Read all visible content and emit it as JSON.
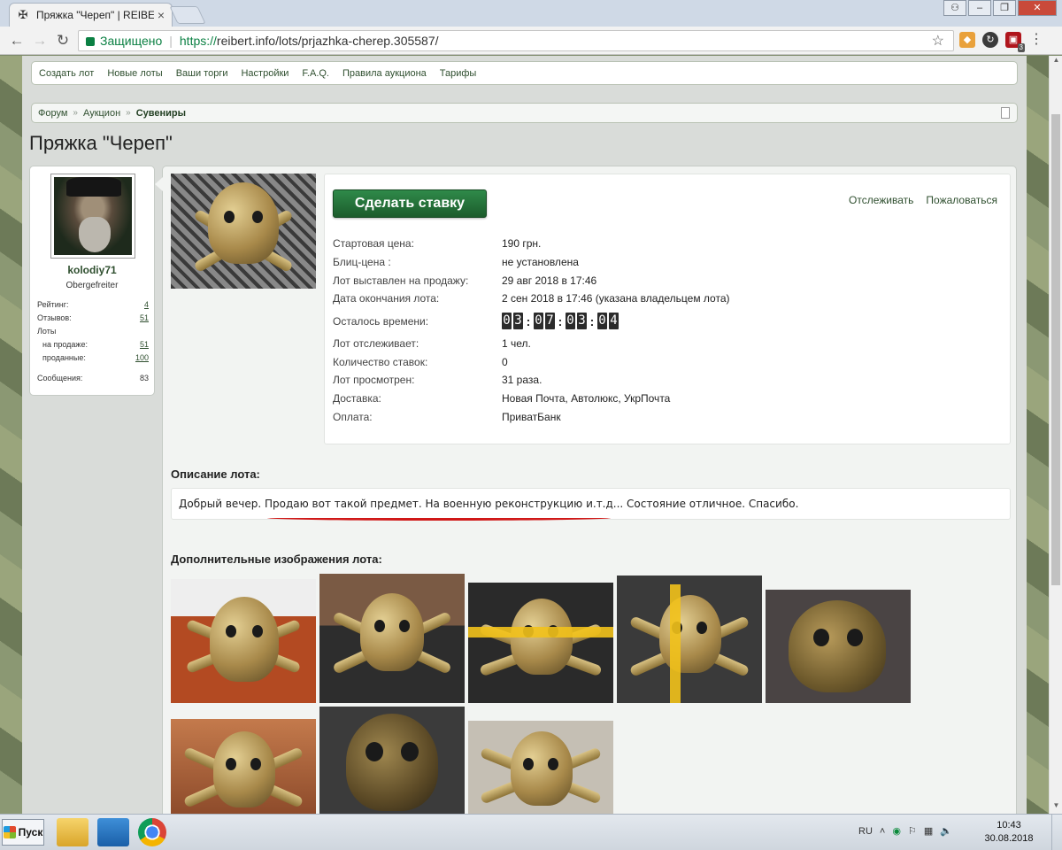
{
  "browser": {
    "tab_title": "Пряжка \"Череп\" | REIBERT",
    "secure_label": "Защищено",
    "url_proto": "https://",
    "url_rest": "reibert.info/lots/prjazhka-cherep.305587/",
    "extension_badge": "3"
  },
  "navbar": {
    "items": [
      "Создать лот",
      "Новые лоты",
      "Ваши торги",
      "Настройки",
      "F.A.Q.",
      "Правила аукциона",
      "Тарифы"
    ]
  },
  "breadcrumb": {
    "items": [
      "Форум",
      "Аукцион"
    ],
    "current": "Сувениры"
  },
  "page_title": "Пряжка \"Череп\"",
  "user": {
    "name": "kolodiy71",
    "rank": "Obergefreiter",
    "stats": [
      {
        "label": "Рейтинг:",
        "value": "4"
      },
      {
        "label": "Отзывов:",
        "value": "51"
      },
      {
        "label": "Лоты",
        "value": ""
      },
      {
        "label": "на продаже:",
        "value": "51"
      },
      {
        "label": "проданные:",
        "value": "100"
      },
      {
        "label": "Сообщения:",
        "value": "83"
      }
    ]
  },
  "lot": {
    "bid_button": "Сделать ставку",
    "watch_link": "Отслеживать",
    "report_link": "Пожаловаться",
    "details": [
      {
        "label": "Стартовая цена:",
        "value": "190 грн."
      },
      {
        "label": "Блиц-цена :",
        "value": "не установлена"
      },
      {
        "label": "Лот выставлен на продажу:",
        "value": "29 авг 2018 в 17:46"
      },
      {
        "label": "Дата окончания лота:",
        "value": "2 сен 2018 в 17:46 (указана владельцем лота)"
      }
    ],
    "time_left_label": "Осталось времени:",
    "timer": [
      "03",
      "07",
      "03",
      "04"
    ],
    "details2": [
      {
        "label": "Лот отслеживает:",
        "value": "1 чел."
      },
      {
        "label": "Количество ставок:",
        "value": "0"
      },
      {
        "label": "Лот просмотрен:",
        "value": "31 раза."
      },
      {
        "label": "Доставка:",
        "value": "Новая Почта, Автолюкс, УкрПочта"
      },
      {
        "label": "Оплата:",
        "value": "ПриватБанк"
      }
    ],
    "description_heading": "Описание лота:",
    "description": "Добрый вечер. Продаю вот такой предмет. На военную реконструкцию и.т.д... Состояние отличное. Спасибо.",
    "more_images_heading": "Дополнительные изображения лота:"
  },
  "taskbar": {
    "start_label": "Пуск",
    "lang": "RU",
    "time": "10:43",
    "date": "30.08.2018"
  }
}
